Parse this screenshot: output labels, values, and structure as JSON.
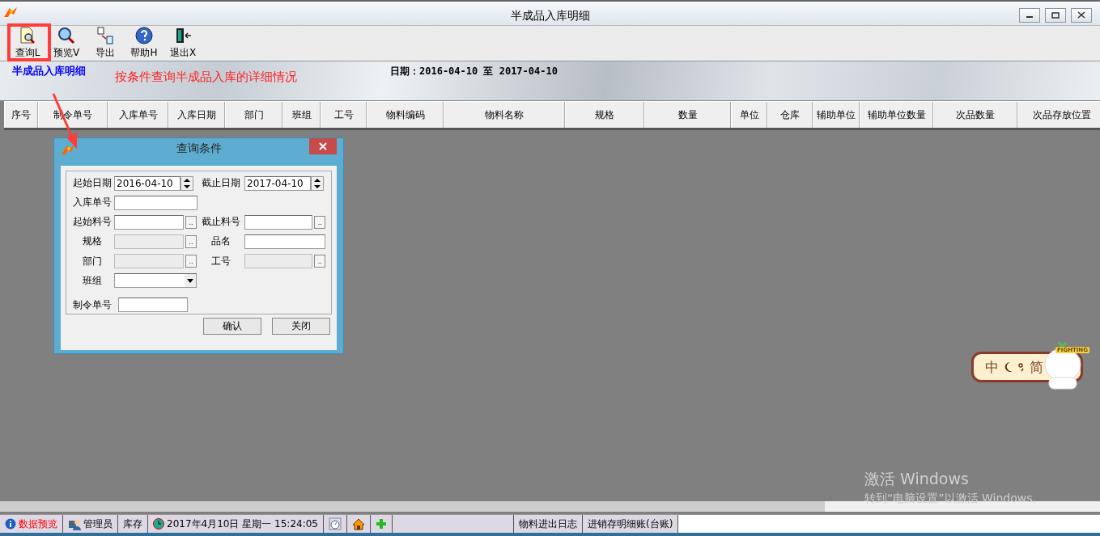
{
  "window": {
    "title": "半成品入库明细"
  },
  "toolbar": [
    {
      "kind": "query",
      "label": "查询L"
    },
    {
      "kind": "preview",
      "label": "预览V"
    },
    {
      "kind": "export",
      "label": "导出"
    },
    {
      "kind": "help",
      "label": "帮助H"
    },
    {
      "kind": "exit",
      "label": "退出X"
    }
  ],
  "banner": {
    "title": "半成品入库明细",
    "date_range": "日期：2016-04-10 至 2017-04-10"
  },
  "table": {
    "columns": [
      {
        "label": "序号"
      },
      {
        "label": "制令单号"
      },
      {
        "label": "入库单号"
      },
      {
        "label": "入库日期"
      },
      {
        "label": "部门"
      },
      {
        "label": "班组"
      },
      {
        "label": "工号"
      },
      {
        "label": "物料编码"
      },
      {
        "label": "物料名称"
      },
      {
        "label": "规格"
      },
      {
        "label": "数量"
      },
      {
        "label": "单位"
      },
      {
        "label": "仓库"
      },
      {
        "label": "辅助单位"
      },
      {
        "label": "辅助单位数量"
      },
      {
        "label": "次品数量"
      },
      {
        "label": "次品存放位置"
      }
    ]
  },
  "annotation": {
    "text": "按条件查询半成品入库的详细情况"
  },
  "dialog": {
    "title": "查询条件",
    "rows": [
      [
        {
          "label": "起始日期",
          "kind": "date",
          "value": "2016-04-10",
          "disabled": false
        },
        {
          "label": "截止日期",
          "kind": "date",
          "value": "2017-04-10",
          "disabled": false
        }
      ],
      [
        {
          "label": "入库单号",
          "kind": "wide",
          "disabled": false
        }
      ],
      [
        {
          "label": "起始料号",
          "kind": "lookup",
          "button": "..",
          "disabled": false
        },
        {
          "label": "截止料号",
          "kind": "lookup",
          "button": "..",
          "disabled": false
        }
      ],
      [
        {
          "label": "规格",
          "kind": "lookup",
          "button": "..",
          "disabled": true
        },
        {
          "label": "品名",
          "kind": "text",
          "disabled": false
        }
      ],
      [
        {
          "label": "部门",
          "kind": "lookup",
          "button": "..",
          "disabled": true
        },
        {
          "label": "工号",
          "kind": "lookup",
          "button": "..",
          "disabled": true
        }
      ],
      [
        {
          "label": "班组",
          "kind": "combo",
          "disabled": false
        }
      ],
      [
        {
          "label": "制令单号",
          "kind": "short",
          "disabled": false
        }
      ]
    ],
    "buttons": [
      "确认",
      "关闭"
    ]
  },
  "ime": {
    "mode": "中",
    "script": "简",
    "badge": "FIGHTING"
  },
  "activation": {
    "title": "激活 Windows",
    "hint": "转到“电脑设置”以激活 Windows。"
  },
  "status_bar": [
    {
      "kind": "info",
      "text": "数据预览",
      "alert": true
    },
    {
      "kind": "user",
      "text": "管理员",
      "alert": false
    },
    {
      "kind": "plain",
      "text": "库存",
      "alert": false
    },
    {
      "kind": "clock",
      "text": "2017年4月10日 星期一 15:24:05",
      "alert": false
    },
    {
      "kind": "stopwatch"
    },
    {
      "kind": "home"
    },
    {
      "kind": "add"
    },
    {
      "kind": "empty"
    },
    {
      "kind": "plain",
      "text": "物料进出日志",
      "alert": false
    },
    {
      "kind": "plain",
      "text": "进销存明细账(台账)",
      "alert": false
    }
  ]
}
